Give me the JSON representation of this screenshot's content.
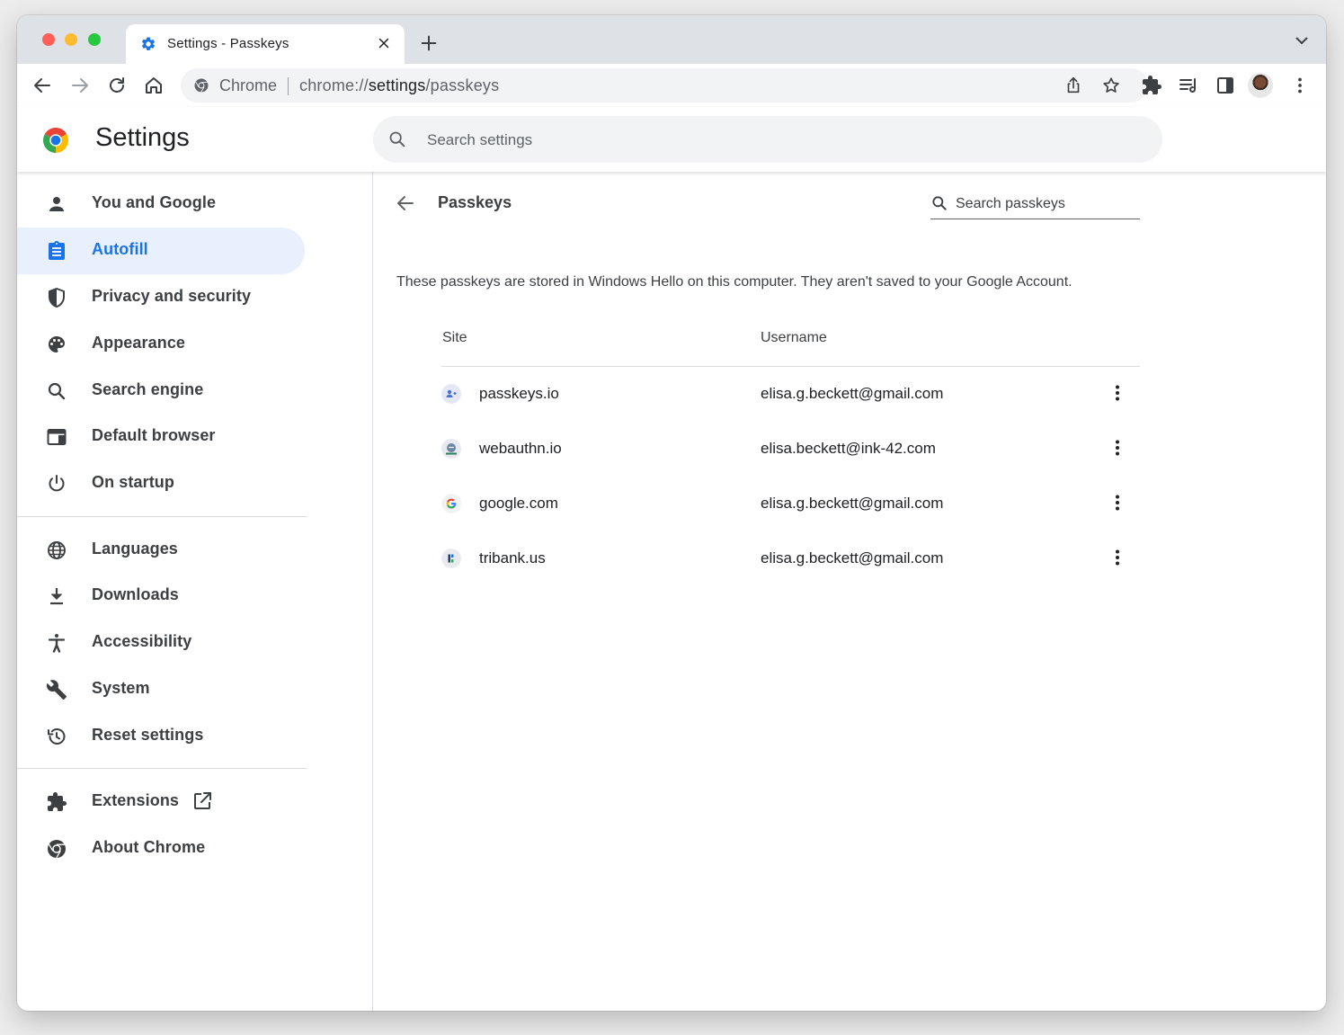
{
  "tab": {
    "title": "Settings - Passkeys",
    "icon": "gear-icon"
  },
  "omnibox": {
    "origin": "Chrome",
    "url_prefix": "chrome://",
    "url_host": "settings",
    "url_path": "/passkeys"
  },
  "header": {
    "title": "Settings",
    "search_placeholder": "Search settings"
  },
  "sidebar": {
    "items": [
      {
        "label": "You and Google",
        "icon": "person-icon"
      },
      {
        "label": "Autofill",
        "icon": "clipboard-icon",
        "active": true
      },
      {
        "label": "Privacy and security",
        "icon": "shield-icon"
      },
      {
        "label": "Appearance",
        "icon": "palette-icon"
      },
      {
        "label": "Search engine",
        "icon": "search-icon"
      },
      {
        "label": "Default browser",
        "icon": "browser-window-icon"
      },
      {
        "label": "On startup",
        "icon": "power-icon"
      },
      {
        "label": "Languages",
        "icon": "globe-icon"
      },
      {
        "label": "Downloads",
        "icon": "download-icon"
      },
      {
        "label": "Accessibility",
        "icon": "accessibility-icon"
      },
      {
        "label": "System",
        "icon": "wrench-icon"
      },
      {
        "label": "Reset settings",
        "icon": "history-icon"
      },
      {
        "label": "Extensions",
        "icon": "puzzle-icon"
      },
      {
        "label": "About Chrome",
        "icon": "chrome-icon"
      }
    ]
  },
  "passkeys": {
    "title": "Passkeys",
    "search_placeholder": "Search passkeys",
    "description": "These passkeys are stored in Windows Hello on this computer. They aren't saved to your Google Account.",
    "columns": {
      "site": "Site",
      "username": "Username"
    },
    "rows": [
      {
        "site": "passkeys.io",
        "username": "elisa.g.beckett@gmail.com",
        "favicon": "passkeys-favicon"
      },
      {
        "site": "webauthn.io",
        "username": "elisa.beckett@ink-42.com",
        "favicon": "webauthn-favicon"
      },
      {
        "site": "google.com",
        "username": "elisa.g.beckett@gmail.com",
        "favicon": "google-favicon"
      },
      {
        "site": "tribank.us",
        "username": "elisa.g.beckett@gmail.com",
        "favicon": "tribank-favicon"
      }
    ]
  },
  "colors": {
    "accent": "#1a73e8",
    "active_bg": "#e8f0fe",
    "tabstrip": "#dee1e6",
    "omnibox_bg": "#f1f3f4"
  }
}
